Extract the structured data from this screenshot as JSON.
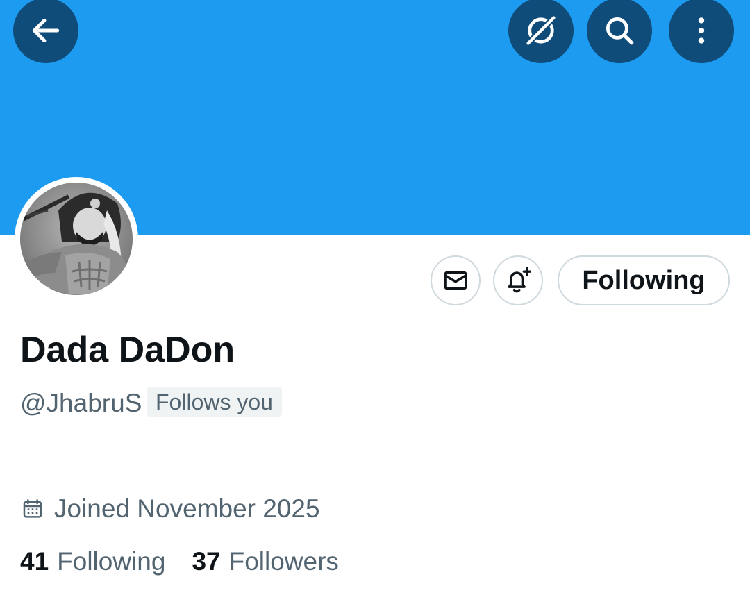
{
  "header": {
    "back_icon": "arrow-left-icon",
    "grok_icon": "grok-icon",
    "search_icon": "search-icon",
    "more_icon": "more-vertical-icon",
    "banner_color": "#1d9bf0",
    "button_color": "#0f4c7a"
  },
  "profile": {
    "display_name": "Dada DaDon",
    "handle": "@JhabruS",
    "follows_you_label": "Follows you",
    "joined": "Joined November 2025",
    "following_count": "41",
    "following_label": "Following",
    "followers_count": "37",
    "followers_label": "Followers"
  },
  "actions": {
    "message_icon": "envelope-icon",
    "notify_icon": "bell-plus-icon",
    "following_button_label": "Following"
  }
}
